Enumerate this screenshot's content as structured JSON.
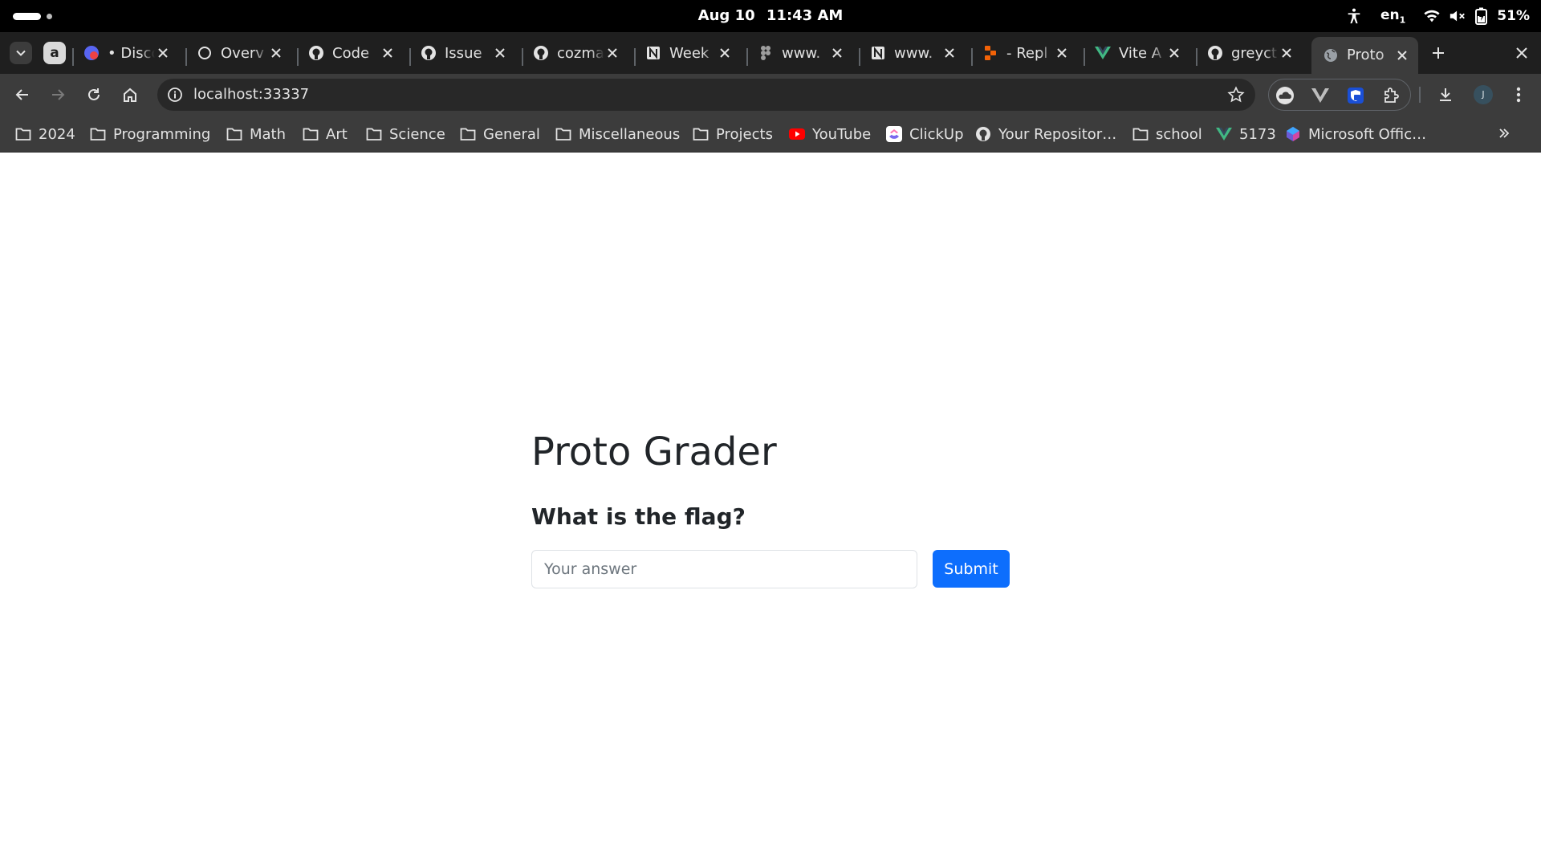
{
  "system_bar": {
    "date": "Aug 10",
    "time": "11:43 AM",
    "keyboard_layout": "en",
    "keyboard_layout_sub": "1",
    "battery": "51%"
  },
  "tabs": [
    {
      "title": "• Disco",
      "icon": "discord-icon"
    },
    {
      "title": "Overv",
      "icon": "circle-icon"
    },
    {
      "title": "Code",
      "icon": "github-icon"
    },
    {
      "title": "Issue",
      "icon": "github-icon"
    },
    {
      "title": "cozma",
      "icon": "github-icon"
    },
    {
      "title": "Week",
      "icon": "notion-icon"
    },
    {
      "title": "www.",
      "icon": "figma-icon"
    },
    {
      "title": "www.",
      "icon": "notion-icon"
    },
    {
      "title": "- Repl",
      "icon": "replit-icon"
    },
    {
      "title": "Vite A",
      "icon": "vue-icon"
    },
    {
      "title": "greyct",
      "icon": "github-icon"
    },
    {
      "title": "Proto",
      "icon": "globe-icon",
      "active": true
    }
  ],
  "toolbar": {
    "url": "localhost:33337",
    "profile_initial": "J"
  },
  "bookmarks": [
    {
      "label": "2024",
      "icon": "folder-icon"
    },
    {
      "label": "Programming",
      "icon": "folder-icon"
    },
    {
      "label": "Math",
      "icon": "folder-icon"
    },
    {
      "label": "Art",
      "icon": "folder-icon"
    },
    {
      "label": "Science",
      "icon": "folder-icon"
    },
    {
      "label": "General",
      "icon": "folder-icon"
    },
    {
      "label": "Miscellaneous",
      "icon": "folder-icon"
    },
    {
      "label": "Projects",
      "icon": "folder-icon"
    },
    {
      "label": "YouTube",
      "icon": "youtube-icon"
    },
    {
      "label": "ClickUp",
      "icon": "clickup-icon"
    },
    {
      "label": "Your Repositor…",
      "icon": "github-icon"
    },
    {
      "label": "school",
      "icon": "folder-icon"
    },
    {
      "label": "5173",
      "icon": "vue-icon"
    },
    {
      "label": "Microsoft Offic…",
      "icon": "copilot-icon"
    }
  ],
  "page": {
    "title": "Proto Grader",
    "question": "What is the flag?",
    "answer_placeholder": "Your answer",
    "answer_value": "",
    "submit_label": "Submit"
  },
  "colors": {
    "primary": "#0d6efd",
    "text": "#212529",
    "chrome_dark": "#3c3c3c"
  }
}
